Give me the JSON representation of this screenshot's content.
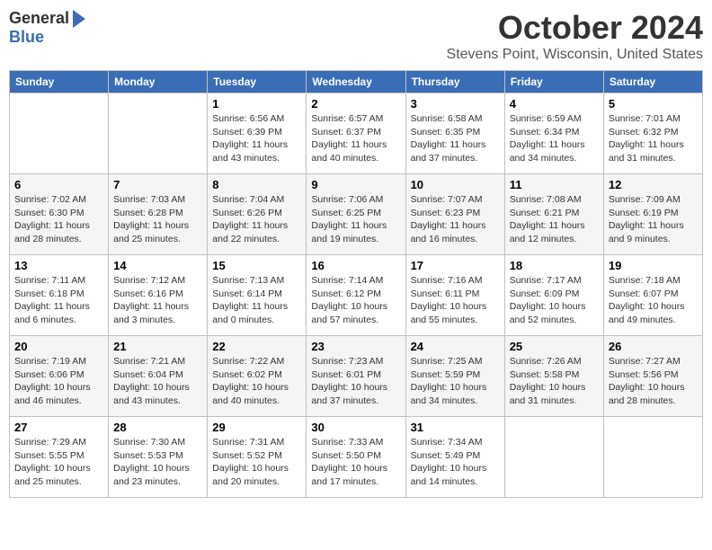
{
  "header": {
    "logo_general": "General",
    "logo_blue": "Blue",
    "month_title": "October 2024",
    "subtitle": "Stevens Point, Wisconsin, United States"
  },
  "days_of_week": [
    "Sunday",
    "Monday",
    "Tuesday",
    "Wednesday",
    "Thursday",
    "Friday",
    "Saturday"
  ],
  "weeks": [
    [
      {
        "day": "",
        "sunrise": "",
        "sunset": "",
        "daylight": ""
      },
      {
        "day": "",
        "sunrise": "",
        "sunset": "",
        "daylight": ""
      },
      {
        "day": "1",
        "sunrise": "Sunrise: 6:56 AM",
        "sunset": "Sunset: 6:39 PM",
        "daylight": "Daylight: 11 hours and 43 minutes."
      },
      {
        "day": "2",
        "sunrise": "Sunrise: 6:57 AM",
        "sunset": "Sunset: 6:37 PM",
        "daylight": "Daylight: 11 hours and 40 minutes."
      },
      {
        "day": "3",
        "sunrise": "Sunrise: 6:58 AM",
        "sunset": "Sunset: 6:35 PM",
        "daylight": "Daylight: 11 hours and 37 minutes."
      },
      {
        "day": "4",
        "sunrise": "Sunrise: 6:59 AM",
        "sunset": "Sunset: 6:34 PM",
        "daylight": "Daylight: 11 hours and 34 minutes."
      },
      {
        "day": "5",
        "sunrise": "Sunrise: 7:01 AM",
        "sunset": "Sunset: 6:32 PM",
        "daylight": "Daylight: 11 hours and 31 minutes."
      }
    ],
    [
      {
        "day": "6",
        "sunrise": "Sunrise: 7:02 AM",
        "sunset": "Sunset: 6:30 PM",
        "daylight": "Daylight: 11 hours and 28 minutes."
      },
      {
        "day": "7",
        "sunrise": "Sunrise: 7:03 AM",
        "sunset": "Sunset: 6:28 PM",
        "daylight": "Daylight: 11 hours and 25 minutes."
      },
      {
        "day": "8",
        "sunrise": "Sunrise: 7:04 AM",
        "sunset": "Sunset: 6:26 PM",
        "daylight": "Daylight: 11 hours and 22 minutes."
      },
      {
        "day": "9",
        "sunrise": "Sunrise: 7:06 AM",
        "sunset": "Sunset: 6:25 PM",
        "daylight": "Daylight: 11 hours and 19 minutes."
      },
      {
        "day": "10",
        "sunrise": "Sunrise: 7:07 AM",
        "sunset": "Sunset: 6:23 PM",
        "daylight": "Daylight: 11 hours and 16 minutes."
      },
      {
        "day": "11",
        "sunrise": "Sunrise: 7:08 AM",
        "sunset": "Sunset: 6:21 PM",
        "daylight": "Daylight: 11 hours and 12 minutes."
      },
      {
        "day": "12",
        "sunrise": "Sunrise: 7:09 AM",
        "sunset": "Sunset: 6:19 PM",
        "daylight": "Daylight: 11 hours and 9 minutes."
      }
    ],
    [
      {
        "day": "13",
        "sunrise": "Sunrise: 7:11 AM",
        "sunset": "Sunset: 6:18 PM",
        "daylight": "Daylight: 11 hours and 6 minutes."
      },
      {
        "day": "14",
        "sunrise": "Sunrise: 7:12 AM",
        "sunset": "Sunset: 6:16 PM",
        "daylight": "Daylight: 11 hours and 3 minutes."
      },
      {
        "day": "15",
        "sunrise": "Sunrise: 7:13 AM",
        "sunset": "Sunset: 6:14 PM",
        "daylight": "Daylight: 11 hours and 0 minutes."
      },
      {
        "day": "16",
        "sunrise": "Sunrise: 7:14 AM",
        "sunset": "Sunset: 6:12 PM",
        "daylight": "Daylight: 10 hours and 57 minutes."
      },
      {
        "day": "17",
        "sunrise": "Sunrise: 7:16 AM",
        "sunset": "Sunset: 6:11 PM",
        "daylight": "Daylight: 10 hours and 55 minutes."
      },
      {
        "day": "18",
        "sunrise": "Sunrise: 7:17 AM",
        "sunset": "Sunset: 6:09 PM",
        "daylight": "Daylight: 10 hours and 52 minutes."
      },
      {
        "day": "19",
        "sunrise": "Sunrise: 7:18 AM",
        "sunset": "Sunset: 6:07 PM",
        "daylight": "Daylight: 10 hours and 49 minutes."
      }
    ],
    [
      {
        "day": "20",
        "sunrise": "Sunrise: 7:19 AM",
        "sunset": "Sunset: 6:06 PM",
        "daylight": "Daylight: 10 hours and 46 minutes."
      },
      {
        "day": "21",
        "sunrise": "Sunrise: 7:21 AM",
        "sunset": "Sunset: 6:04 PM",
        "daylight": "Daylight: 10 hours and 43 minutes."
      },
      {
        "day": "22",
        "sunrise": "Sunrise: 7:22 AM",
        "sunset": "Sunset: 6:02 PM",
        "daylight": "Daylight: 10 hours and 40 minutes."
      },
      {
        "day": "23",
        "sunrise": "Sunrise: 7:23 AM",
        "sunset": "Sunset: 6:01 PM",
        "daylight": "Daylight: 10 hours and 37 minutes."
      },
      {
        "day": "24",
        "sunrise": "Sunrise: 7:25 AM",
        "sunset": "Sunset: 5:59 PM",
        "daylight": "Daylight: 10 hours and 34 minutes."
      },
      {
        "day": "25",
        "sunrise": "Sunrise: 7:26 AM",
        "sunset": "Sunset: 5:58 PM",
        "daylight": "Daylight: 10 hours and 31 minutes."
      },
      {
        "day": "26",
        "sunrise": "Sunrise: 7:27 AM",
        "sunset": "Sunset: 5:56 PM",
        "daylight": "Daylight: 10 hours and 28 minutes."
      }
    ],
    [
      {
        "day": "27",
        "sunrise": "Sunrise: 7:29 AM",
        "sunset": "Sunset: 5:55 PM",
        "daylight": "Daylight: 10 hours and 25 minutes."
      },
      {
        "day": "28",
        "sunrise": "Sunrise: 7:30 AM",
        "sunset": "Sunset: 5:53 PM",
        "daylight": "Daylight: 10 hours and 23 minutes."
      },
      {
        "day": "29",
        "sunrise": "Sunrise: 7:31 AM",
        "sunset": "Sunset: 5:52 PM",
        "daylight": "Daylight: 10 hours and 20 minutes."
      },
      {
        "day": "30",
        "sunrise": "Sunrise: 7:33 AM",
        "sunset": "Sunset: 5:50 PM",
        "daylight": "Daylight: 10 hours and 17 minutes."
      },
      {
        "day": "31",
        "sunrise": "Sunrise: 7:34 AM",
        "sunset": "Sunset: 5:49 PM",
        "daylight": "Daylight: 10 hours and 14 minutes."
      },
      {
        "day": "",
        "sunrise": "",
        "sunset": "",
        "daylight": ""
      },
      {
        "day": "",
        "sunrise": "",
        "sunset": "",
        "daylight": ""
      }
    ]
  ]
}
